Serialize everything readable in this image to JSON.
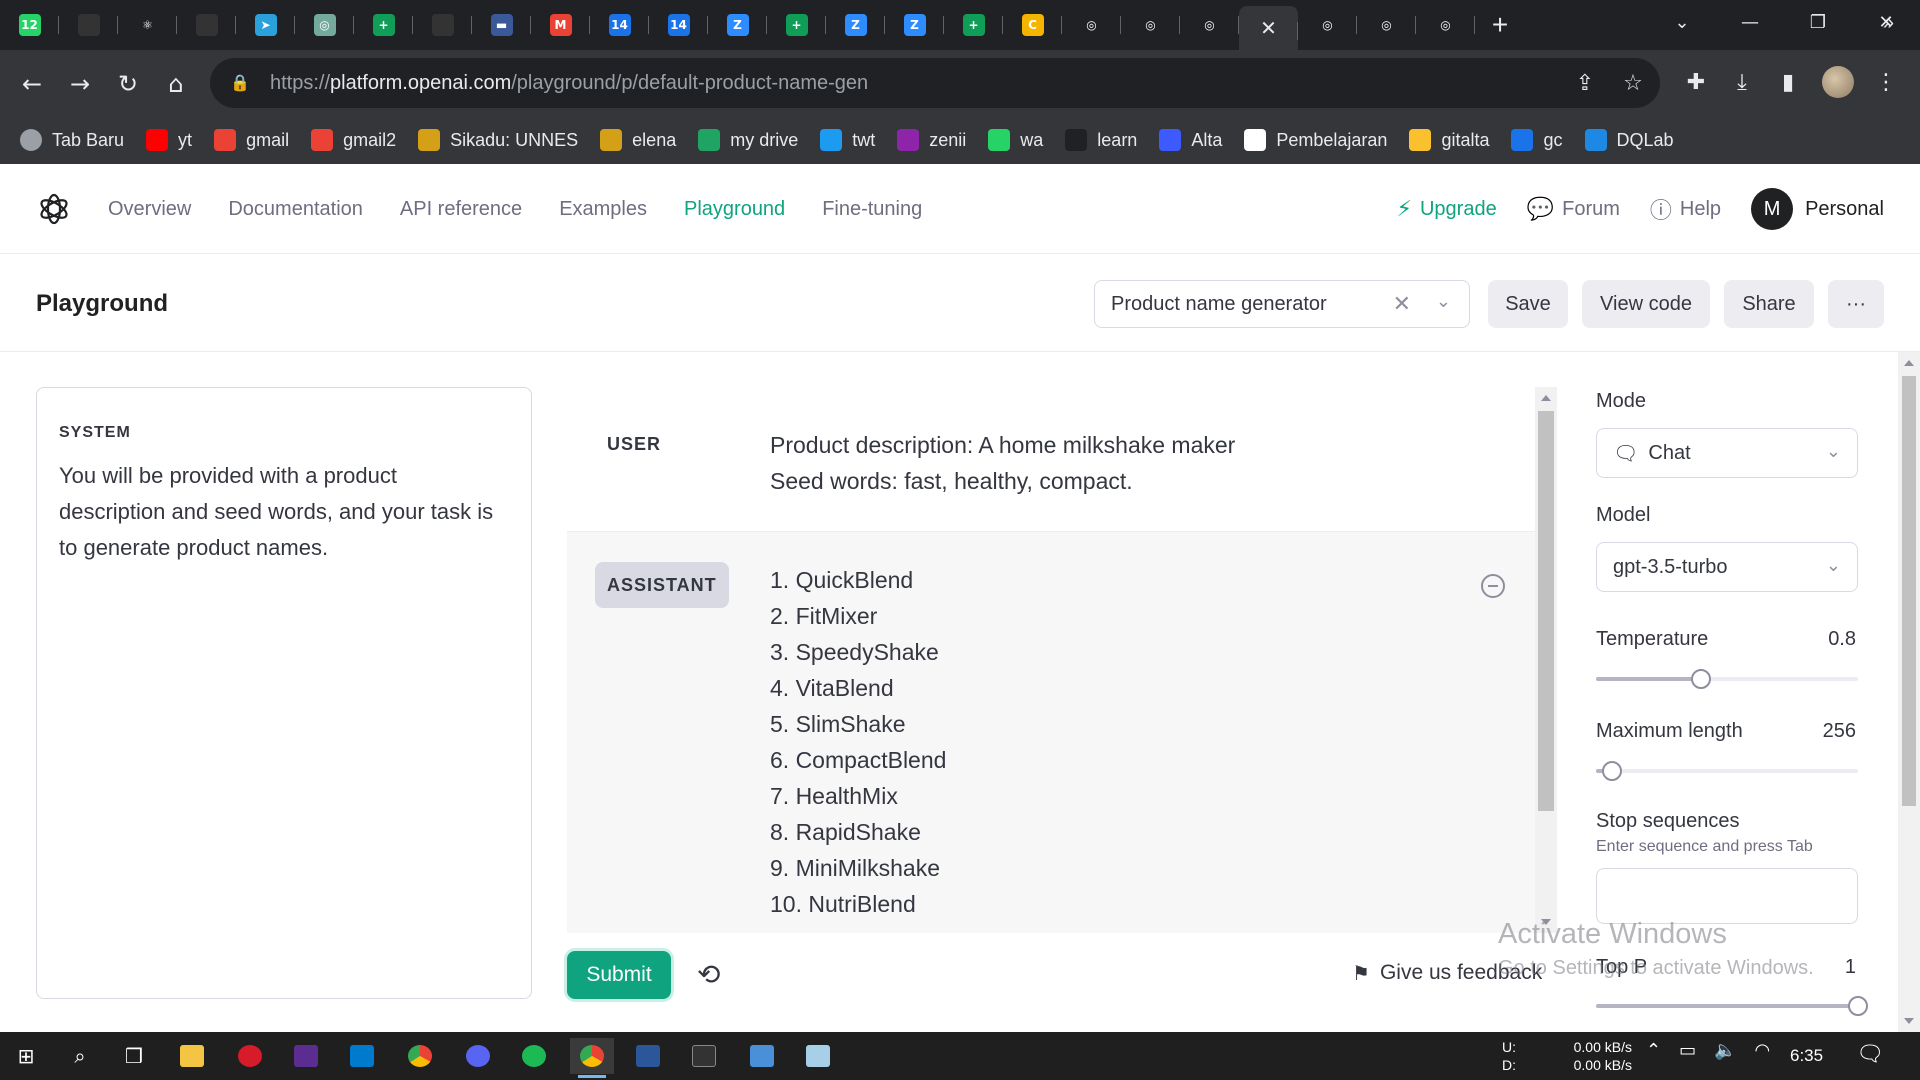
{
  "browser": {
    "tabs": [
      {
        "icon": "whatsapp-icon",
        "glyph": "12",
        "color": "#25d366"
      },
      {
        "icon": "github-icon",
        "glyph": "",
        "color": "#333333"
      },
      {
        "icon": "react-icon",
        "glyph": "⚛",
        "color": "#202124"
      },
      {
        "icon": "github-icon",
        "glyph": "",
        "color": "#333333"
      },
      {
        "icon": "telegram-icon",
        "glyph": "➤",
        "color": "#2aa1da"
      },
      {
        "icon": "chatgpt-icon",
        "glyph": "◎",
        "color": "#74aa9c"
      },
      {
        "icon": "sheets-icon",
        "glyph": "+",
        "color": "#0f9d58"
      },
      {
        "icon": "github-icon",
        "glyph": "",
        "color": "#333333"
      },
      {
        "icon": "site-icon",
        "glyph": "▬",
        "color": "#3b5998"
      },
      {
        "icon": "gmail-icon",
        "glyph": "M",
        "color": "#ea4335"
      },
      {
        "icon": "calendar-icon",
        "glyph": "14",
        "color": "#1a73e8"
      },
      {
        "icon": "calendar-icon",
        "glyph": "14",
        "color": "#1a73e8"
      },
      {
        "icon": "zoom-icon",
        "glyph": "Z",
        "color": "#2d8cff"
      },
      {
        "icon": "sheets-icon",
        "glyph": "+",
        "color": "#0f9d58"
      },
      {
        "icon": "zoom-icon",
        "glyph": "Z",
        "color": "#2d8cff"
      },
      {
        "icon": "zoom-icon",
        "glyph": "Z",
        "color": "#2d8cff"
      },
      {
        "icon": "sheets-icon",
        "glyph": "+",
        "color": "#0f9d58"
      },
      {
        "icon": "classroom-icon",
        "glyph": "C",
        "color": "#f4b400"
      },
      {
        "icon": "openai-icon",
        "glyph": "◎",
        "color": "#202124"
      },
      {
        "icon": "openai-icon",
        "glyph": "◎",
        "color": "#202124"
      },
      {
        "icon": "openai-icon",
        "glyph": "◎",
        "color": "#202124"
      },
      {
        "icon": "close-icon",
        "glyph": "✕",
        "color": "#35363a",
        "active": true
      },
      {
        "icon": "openai-icon",
        "glyph": "◎",
        "color": "#202124"
      },
      {
        "icon": "openai-icon",
        "glyph": "◎",
        "color": "#202124"
      },
      {
        "icon": "openai-icon",
        "glyph": "◎",
        "color": "#202124"
      }
    ],
    "url_prefix": "https://",
    "url_host": "platform.openai.com",
    "url_path": "/playground/p/default-product-name-gen",
    "bookmarks": [
      {
        "label": "Tab Baru",
        "icon": "globe-icon",
        "color": "#9aa0a6"
      },
      {
        "label": "yt",
        "icon": "youtube-icon",
        "color": "#ff0000"
      },
      {
        "label": "gmail",
        "icon": "gmail-icon",
        "color": "#ea4335"
      },
      {
        "label": "gmail2",
        "icon": "gmail-icon",
        "color": "#ea4335"
      },
      {
        "label": "Sikadu: UNNES",
        "icon": "unnes-icon",
        "color": "#d4a017"
      },
      {
        "label": "elena",
        "icon": "unnes-icon",
        "color": "#d4a017"
      },
      {
        "label": "my drive",
        "icon": "drive-icon",
        "color": "#1fa463"
      },
      {
        "label": "twt",
        "icon": "twitter-icon",
        "color": "#1d9bf0"
      },
      {
        "label": "zenii",
        "icon": "zenius-icon",
        "color": "#8e24aa"
      },
      {
        "label": "wa",
        "icon": "whatsapp-icon",
        "color": "#25d366"
      },
      {
        "label": "learn",
        "icon": "dicoding-icon",
        "color": "#202124"
      },
      {
        "label": "Alta",
        "icon": "alta-icon",
        "color": "#3d5afe"
      },
      {
        "label": "Pembelajaran",
        "icon": "notion-icon",
        "color": "#ffffff"
      },
      {
        "label": "gitalta",
        "icon": "folder-icon",
        "color": "#fbc02d"
      },
      {
        "label": "gc",
        "icon": "calendar-icon",
        "color": "#1a73e8"
      },
      {
        "label": "DQLab",
        "icon": "dqlab-icon",
        "color": "#1e88e5"
      }
    ]
  },
  "header": {
    "nav": [
      "Overview",
      "Documentation",
      "API reference",
      "Examples",
      "Playground",
      "Fine-tuning"
    ],
    "active_nav": "Playground",
    "upgrade": "Upgrade",
    "forum": "Forum",
    "help": "Help",
    "avatar_letter": "M",
    "account": "Personal"
  },
  "playground": {
    "title": "Playground",
    "preset": "Product name generator",
    "save": "Save",
    "view_code": "View code",
    "share": "Share",
    "more": "···"
  },
  "system": {
    "label": "SYSTEM",
    "text": "You will be provided with a product description and seed words, and your task is to generate product names."
  },
  "messages": {
    "user_role": "USER",
    "user_text": "Product description: A home milkshake maker\nSeed words: fast, healthy, compact.",
    "assistant_role": "ASSISTANT",
    "assistant_items": [
      "1. QuickBlend",
      "2. FitMixer",
      "3. SpeedyShake",
      "4. VitaBlend",
      "5. SlimShake",
      "6. CompactBlend",
      "7. HealthMix",
      "8. RapidShake",
      "9. MiniMilkshake",
      "10. NutriBlend"
    ]
  },
  "actions": {
    "submit": "Submit",
    "feedback": "Give us feedback"
  },
  "settings": {
    "mode_label": "Mode",
    "mode_value": "Chat",
    "model_label": "Model",
    "model_value": "gpt-3.5-turbo",
    "temperature_label": "Temperature",
    "temperature_value": "0.8",
    "temperature_fraction": 0.4,
    "max_length_label": "Maximum length",
    "max_length_value": "256",
    "max_length_fraction": 0.06,
    "stop_label": "Stop sequences",
    "stop_hint": "Enter sequence and press Tab",
    "top_p_label": "Top P",
    "top_p_value": "1",
    "top_p_fraction": 1.0
  },
  "watermark": {
    "line1": "Activate Windows",
    "line2": "Go to Settings to activate Windows."
  },
  "taskbar": {
    "net_labels": "U:\nD:",
    "upload": "0.00 kB/s",
    "download": "0.00 kB/s",
    "time": "6:35"
  },
  "colors": {
    "accent": "#10a37f",
    "text": "#353740",
    "muted": "#6e6e80"
  }
}
